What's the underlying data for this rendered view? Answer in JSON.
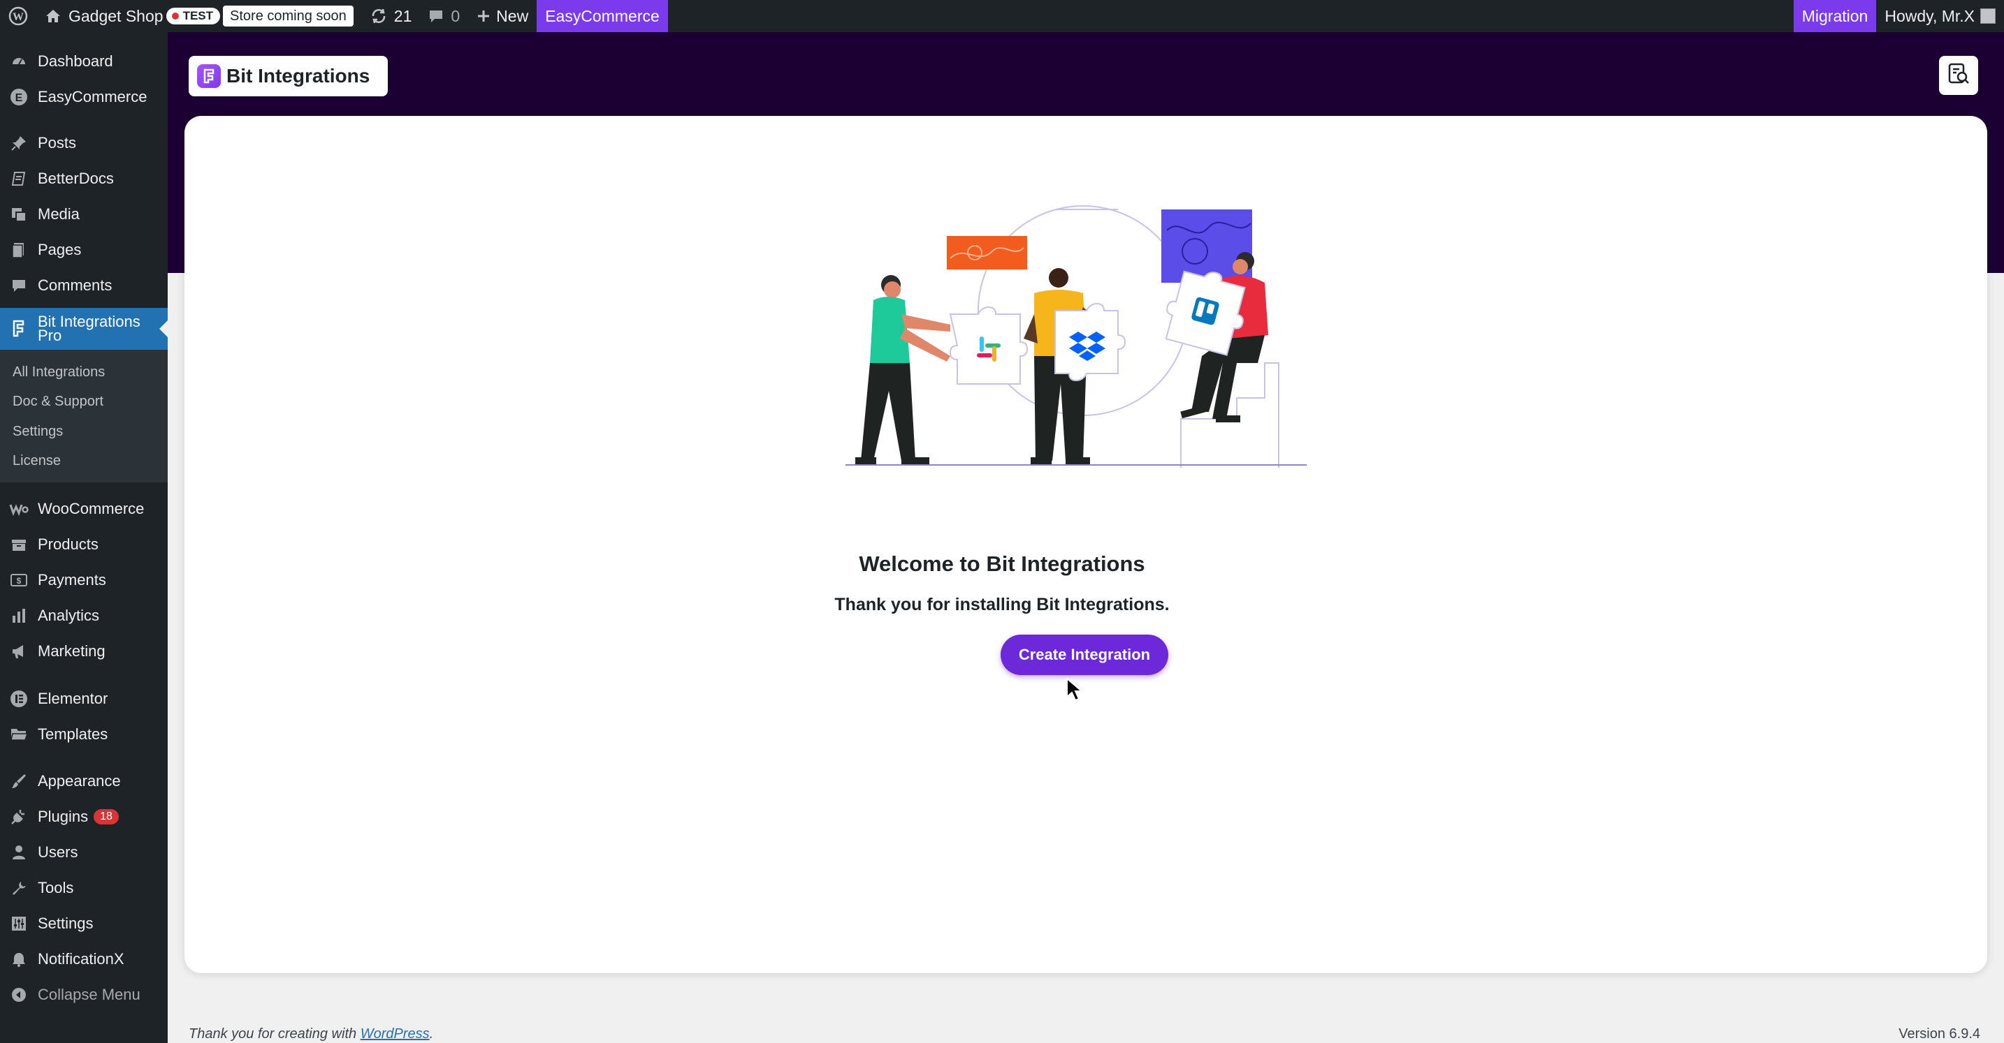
{
  "adminbar": {
    "site_name": "Gadget Shop",
    "test_label": "TEST",
    "store_status": "Store coming soon",
    "updates_count": "21",
    "comments_count": "0",
    "new_label": "New",
    "easycommerce_label": "EasyCommerce",
    "migration_label": "Migration",
    "howdy_label": "Howdy, Mr.X"
  },
  "sidebar": {
    "items": [
      {
        "label": "Dashboard",
        "icon": "dashboard-icon"
      },
      {
        "label": "EasyCommerce",
        "icon": "easycommerce-icon"
      },
      {
        "label": "Posts",
        "icon": "pin-icon"
      },
      {
        "label": "BetterDocs",
        "icon": "docs-icon"
      },
      {
        "label": "Media",
        "icon": "media-icon"
      },
      {
        "label": "Pages",
        "icon": "pages-icon"
      },
      {
        "label": "Comments",
        "icon": "comment-icon"
      },
      {
        "label": "Bit Integrations Pro",
        "icon": "bit-integrations-icon"
      },
      {
        "label": "WooCommerce",
        "icon": "woocommerce-icon"
      },
      {
        "label": "Products",
        "icon": "products-icon"
      },
      {
        "label": "Payments",
        "icon": "payments-icon"
      },
      {
        "label": "Analytics",
        "icon": "analytics-icon"
      },
      {
        "label": "Marketing",
        "icon": "megaphone-icon"
      },
      {
        "label": "Elementor",
        "icon": "elementor-icon"
      },
      {
        "label": "Templates",
        "icon": "folder-icon"
      },
      {
        "label": "Appearance",
        "icon": "brush-icon"
      },
      {
        "label": "Plugins",
        "icon": "plugin-icon",
        "badge": "18"
      },
      {
        "label": "Users",
        "icon": "user-icon"
      },
      {
        "label": "Tools",
        "icon": "wrench-icon"
      },
      {
        "label": "Settings",
        "icon": "settings-icon"
      },
      {
        "label": "NotificationX",
        "icon": "bell-icon"
      }
    ],
    "submenu": [
      "All Integrations",
      "Doc & Support",
      "Settings",
      "License"
    ],
    "collapse_label": "Collapse Menu"
  },
  "header": {
    "logo_text": "Bit Integrations"
  },
  "main": {
    "title": "Welcome to Bit Integrations",
    "subtitle": "Thank you for installing Bit Integrations.",
    "create_button": "Create Integration"
  },
  "footer": {
    "thanks_prefix": "Thank you for creating with",
    "wordpress_link": "WordPress",
    "thanks_suffix": ".",
    "version": "Version 6.9.4"
  },
  "colors": {
    "accent": "#6d28d9",
    "admin_bar": "#1d2327",
    "header_bg": "#1c0034",
    "active_menu": "#2271b1"
  }
}
